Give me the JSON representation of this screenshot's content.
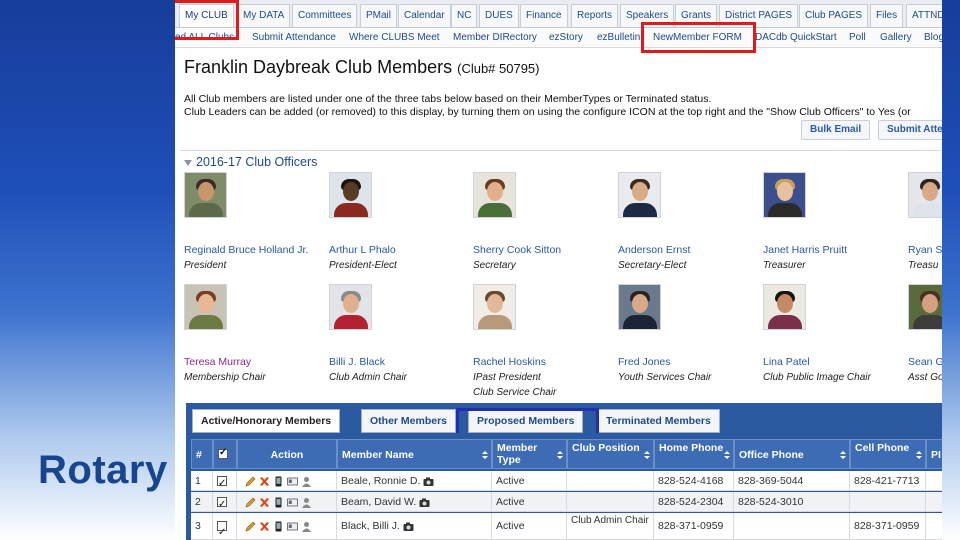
{
  "slide": {
    "brand": "Rotary"
  },
  "tabs": [
    "My CLUB",
    "My DATA",
    "Committees",
    "PMail",
    "Calendar",
    "NC",
    "DUES",
    "Finance",
    "Reports",
    "Speakers",
    "Grants",
    "District PAGES",
    "Club PAGES",
    "Files",
    "ATTND"
  ],
  "subnav": [
    "ed ALL Clubs",
    "Submit Attendance",
    "Where CLUBS Meet",
    "Member DIRectory",
    "ezStory",
    "ezBulletin",
    "NewMember FORM",
    "DACdb QuickStart",
    "Poll",
    "Gallery",
    "Blog"
  ],
  "page": {
    "title": "Franklin Daybreak Club Members",
    "club_number": "(Club# 50795)",
    "description_1": "All Club members are listed under one of the three tabs below based on their MemberTypes or Terminated status.",
    "description_2": "Club Leaders can be added (or removed) to this display, by turning them on using the configure ICON at the top right and the \"Show Club Officers\" to Yes (or",
    "bulk_email": "Bulk Email",
    "submit_attendance": "Submit Atte"
  },
  "officers_section": {
    "title": "2016-17 Club Officers",
    "officers": [
      {
        "name": "Reginald Bruce Holland Jr.",
        "role": "President",
        "role2": ""
      },
      {
        "name": "Arthur L Phalo",
        "role": "President-Elect",
        "role2": ""
      },
      {
        "name": "Sherry Cook Sitton",
        "role": "Secretary",
        "role2": ""
      },
      {
        "name": "Anderson Ernst",
        "role": "Secretary-Elect",
        "role2": ""
      },
      {
        "name": "Janet Harris Pruitt",
        "role": "Treasurer",
        "role2": ""
      },
      {
        "name": "Ryan S",
        "role": "Treasu",
        "role2": ""
      },
      {
        "name": "Teresa Murray",
        "role": "Membership Chair",
        "role2": ""
      },
      {
        "name": "Billi J. Black",
        "role": "Club Admin Chair",
        "role2": ""
      },
      {
        "name": "Rachel Hoskins",
        "role": "IPast President",
        "role2": "Club Service Chair"
      },
      {
        "name": "Fred Jones",
        "role": "Youth Services Chair",
        "role2": ""
      },
      {
        "name": "Lina Patel",
        "role": "Club Public Image Chair",
        "role2": ""
      },
      {
        "name": "Sean G",
        "role": "Asst Go",
        "role2": ""
      }
    ]
  },
  "member_tabs": [
    "Active/Honorary Members",
    "Other Members",
    "Proposed Members",
    "Terminated Members"
  ],
  "table": {
    "headers": [
      "#",
      "",
      "Action",
      "Member Name",
      "Member Type",
      "Club Position",
      "Home Phone",
      "Office Phone",
      "Cell Phone",
      "PI"
    ],
    "rows": [
      {
        "num": "1",
        "name": "Beale, Ronnie D.",
        "type": "Active",
        "position": "",
        "home": "828-524-4168",
        "office": "828-369-5044",
        "cell": "828-421-7713"
      },
      {
        "num": "2",
        "name": "Beam, David W.",
        "type": "Active",
        "position": "",
        "home": "828-524-2304",
        "office": "828-524-3010",
        "cell": ""
      },
      {
        "num": "3",
        "name": "Black, Billi J.",
        "type": "Active",
        "position": "Club Admin Chair",
        "home": "828-371-0959",
        "office": "",
        "cell": "828-371-0959"
      }
    ]
  },
  "colors": {
    "highlight_red": "#e01b1b",
    "highlight_blue": "#1f2fb0",
    "table_blue": "#2c5aa0",
    "link_blue": "#2a56a8"
  }
}
